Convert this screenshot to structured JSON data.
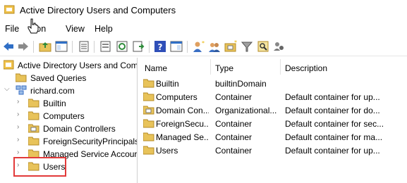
{
  "window": {
    "title": "Active Directory Users and Computers"
  },
  "menu": [
    {
      "label": "File"
    },
    {
      "label": "Action"
    },
    {
      "label": "View"
    },
    {
      "label": "Help"
    }
  ],
  "menu_visible_fragment": "tion",
  "tree": {
    "root": "Active Directory Users and Com",
    "saved_queries": "Saved Queries",
    "domain": "richard.com",
    "children": [
      "Builtin",
      "Computers",
      "Domain Controllers",
      "ForeignSecurityPrincipals",
      "Managed Service Accour",
      "Users"
    ]
  },
  "list": {
    "columns": [
      "Name",
      "Type",
      "Description"
    ],
    "rows": [
      {
        "name": "Builtin",
        "type": "builtinDomain",
        "description": ""
      },
      {
        "name": "Computers",
        "type": "Container",
        "description": "Default container for up..."
      },
      {
        "name": "Domain Con...",
        "type": "Organizational...",
        "description": "Default container for do..."
      },
      {
        "name": "ForeignSecu...",
        "type": "Container",
        "description": "Default container for sec..."
      },
      {
        "name": "Managed Se...",
        "type": "Container",
        "description": "Default container for ma..."
      },
      {
        "name": "Users",
        "type": "Container",
        "description": "Default container for up..."
      }
    ]
  },
  "colors": {
    "folder": "#e8c35a",
    "highlight": "#e23a3a",
    "toolbar_blue": "#2f6fc6"
  },
  "icons": {
    "toolbar": [
      "back-arrow-icon",
      "forward-arrow-icon",
      "up-folder-icon",
      "console-tree-icon",
      "properties-icon",
      "export-icon",
      "refresh-icon",
      "export-list-icon",
      "help-icon",
      "show-pane-icon",
      "add-user-icon",
      "add-group-icon",
      "add-ou-icon",
      "filter-icon",
      "find-icon",
      "delegate-icon"
    ]
  }
}
